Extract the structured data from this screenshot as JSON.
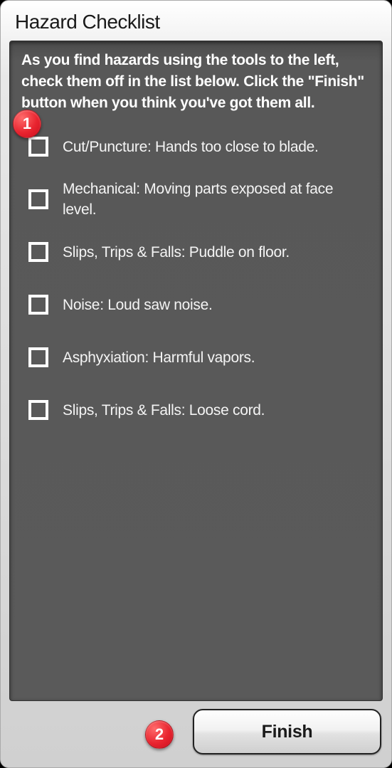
{
  "panel": {
    "title": "Hazard Checklist",
    "instructions": "As you find hazards using the tools to the left, check them off in the list below. Click the \"Finish\" button when you think you've got them all.",
    "items": [
      {
        "label": "Cut/Puncture: Hands too close to blade.",
        "checked": false
      },
      {
        "label": "Mechanical: Moving parts exposed at face level.",
        "checked": false
      },
      {
        "label": "Slips, Trips & Falls: Puddle on floor.",
        "checked": false
      },
      {
        "label": "Noise: Loud saw noise.",
        "checked": false
      },
      {
        "label": "Asphyxiation: Harmful vapors.",
        "checked": false
      },
      {
        "label": "Slips, Trips & Falls: Loose cord.",
        "checked": false
      }
    ],
    "finish_label": "Finish"
  },
  "callouts": [
    {
      "number": "1"
    },
    {
      "number": "2"
    }
  ]
}
